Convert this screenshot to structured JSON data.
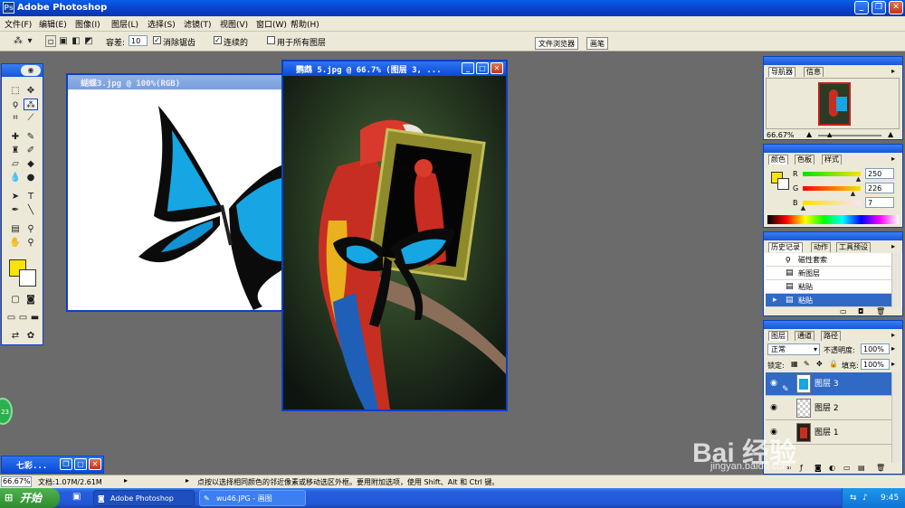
{
  "app": {
    "title": "Adobe Photoshop"
  },
  "menu": [
    "文件(F)",
    "编辑(E)",
    "图像(I)",
    "图层(L)",
    "选择(S)",
    "滤镜(T)",
    "视图(V)",
    "窗口(W)",
    "帮助(H)"
  ],
  "options": {
    "tolerance_label": "容差:",
    "tolerance_value": "10",
    "antialias_label": "消除锯齿",
    "contiguous_label": "连续的",
    "all_layers_label": "用于所有图层",
    "tab_file_browser": "文件浏览器",
    "tab_brushes": "画笔"
  },
  "documents": {
    "butterfly": {
      "title": "蝴蝶3.jpg @ 100%(RGB)"
    },
    "parrot": {
      "title": "鹦鹉 5.jpg @ 66.7% (图层 3, ..."
    },
    "minimized": {
      "title": "七彩..."
    }
  },
  "panels": {
    "navigator": {
      "tabs": [
        "导航器",
        "信息"
      ],
      "zoom": "66.67%"
    },
    "color": {
      "tabs": [
        "颜色",
        "色板",
        "样式"
      ],
      "channels": [
        {
          "label": "R",
          "value": "250",
          "level": 0.98
        },
        {
          "label": "G",
          "value": "226",
          "level": 0.886
        },
        {
          "label": "B",
          "value": "7",
          "level": 0.027
        }
      ]
    },
    "history": {
      "tabs": [
        "历史记录",
        "动作",
        "工具预设"
      ],
      "items": [
        "磁性套索",
        "新图层",
        "粘贴",
        "粘贴"
      ]
    },
    "layers": {
      "tabs": [
        "图层",
        "通道",
        "路径"
      ],
      "blend_mode": "正常",
      "opacity_label": "不透明度:",
      "opacity_value": "100%",
      "lock_label": "锁定:",
      "fill_label": "填充:",
      "fill_value": "100%",
      "items": [
        "图层 3",
        "图层 2",
        "图层 1"
      ]
    }
  },
  "colors": {
    "foreground": "#fae207",
    "background": "#ffffff"
  },
  "status": {
    "zoom": "66.67%",
    "doc": "文档:1.07M/2.61M",
    "hint": "点按以选择相同颜色的邻近像素或移动选区外框。要用附加选项，使用 Shift、Alt 和 Ctrl 键。"
  },
  "taskbar": {
    "start": "开始",
    "tasks": [
      "Adobe Photoshop",
      "wu46.JPG - 画图"
    ],
    "clock": "9:45"
  },
  "watermark": {
    "text": "Bai 经验",
    "url": "jingyan.baidu.com"
  },
  "badge": "23"
}
